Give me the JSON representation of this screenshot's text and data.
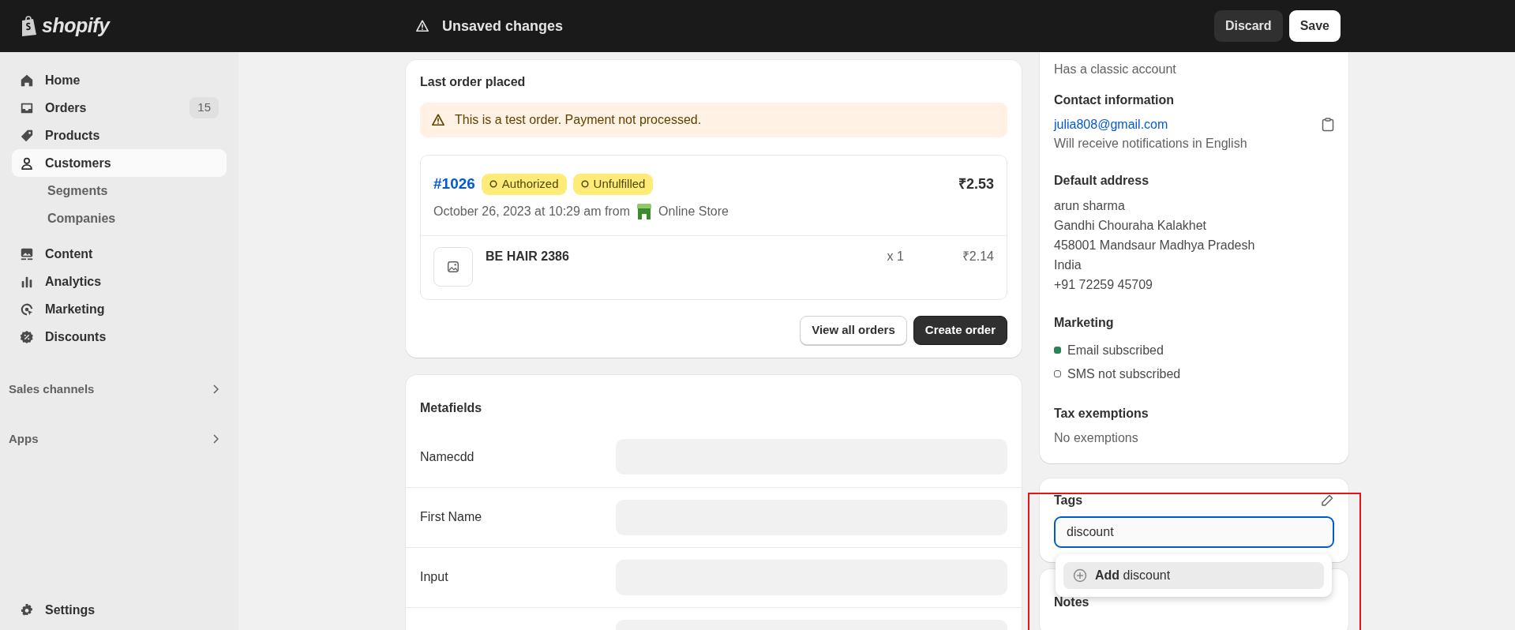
{
  "topbar": {
    "logo": "shopify",
    "message": "Unsaved changes",
    "buttons": [
      {
        "label": "Discard",
        "kind": "secondary"
      },
      {
        "label": "Save",
        "kind": "primary"
      }
    ]
  },
  "sidebar": {
    "items": [
      {
        "label": "Home",
        "selected": false
      },
      {
        "label": "Orders",
        "selected": false,
        "badge": "15"
      },
      {
        "label": "Products",
        "selected": false
      },
      {
        "label": "Customers",
        "selected": true,
        "children": [
          {
            "label": "Segments",
            "selected": false
          },
          {
            "label": "Companies",
            "selected": false
          }
        ]
      },
      {
        "label": "Content",
        "selected": false
      },
      {
        "label": "Analytics",
        "selected": false
      },
      {
        "label": "Marketing",
        "selected": false
      },
      {
        "label": "Discounts",
        "selected": false
      }
    ],
    "sections": [
      {
        "label": "Sales channels"
      },
      {
        "label": "Apps"
      }
    ],
    "footer": {
      "label": "Settings"
    }
  },
  "last_order": {
    "title": "Last order placed",
    "alert": "This is a test order. Payment not processed.",
    "order": {
      "number": "#1026",
      "badges": [
        "Authorized",
        "Unfulfilled"
      ],
      "total": "₹2.53",
      "date": "October 26, 2023 at 10:29 am from",
      "channel": "Online Store",
      "items": [
        {
          "name": "BE HAIR 2386",
          "quantity": "x 1",
          "price": "₹2.14"
        }
      ]
    },
    "buttons": [
      {
        "label": "View all orders",
        "kind": "secondary"
      },
      {
        "label": "Create order",
        "kind": "primary"
      }
    ]
  },
  "metafields": {
    "title": "Metafields",
    "rows": [
      {
        "label": "Namecdd"
      },
      {
        "label": "First Name"
      },
      {
        "label": "Input"
      },
      {}
    ]
  },
  "customer": {
    "account_note": "Has a classic account",
    "contact": {
      "title": "Contact information",
      "email": "julia808@gmail.com",
      "note": "Will receive notifications in English"
    },
    "address": {
      "title": "Default address",
      "lines": [
        "arun sharma",
        "Gandhi Chouraha Kalakhet",
        "458001 Mandsaur Madhya Pradesh",
        "India",
        "+91 72259 45709"
      ]
    },
    "marketing": {
      "title": "Marketing",
      "items": [
        {
          "label": "Email subscribed",
          "subscribed": true
        },
        {
          "label": "SMS not subscribed",
          "subscribed": false
        }
      ]
    },
    "tax": {
      "title": "Tax exemptions",
      "value": "No exemptions"
    }
  },
  "tags": {
    "title": "Tags",
    "value": "discount",
    "suggestion": "**Add** discount"
  },
  "notes": {
    "title": "Notes"
  }
}
